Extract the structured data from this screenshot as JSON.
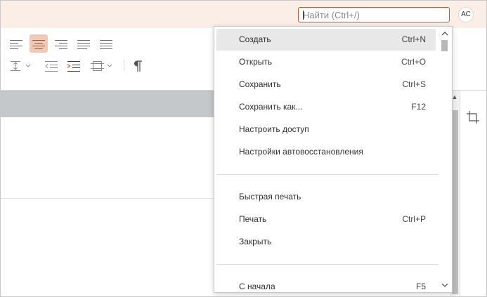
{
  "header": {
    "search_placeholder": "Найти (Ctrl+/)",
    "avatar_initials": "АС"
  },
  "colors": {
    "accent": "#c4573a",
    "titlebar_bg": "#fbeee7",
    "active_button_bg": "#f2c9b8"
  },
  "toolbar": {
    "row1_icons": [
      "align-left-icon",
      "align-center-icon",
      "align-right-icon",
      "align-justify-icon",
      "distributed-align-icon"
    ],
    "row2_icons": [
      "line-spacing-icon",
      "decrease-indent-icon",
      "increase-indent-icon",
      "margins-icon",
      "paragraph-marks-icon"
    ],
    "active": "align-center-icon"
  },
  "menu": {
    "items": [
      {
        "label": "Создать",
        "shortcut": "Ctrl+N"
      },
      {
        "label": "Открыть",
        "shortcut": "Ctrl+O"
      },
      {
        "label": "Сохранить",
        "shortcut": "Ctrl+S"
      },
      {
        "label": "Сохранить как...",
        "shortcut": "F12"
      },
      {
        "label": "Настроить доступ",
        "shortcut": ""
      },
      {
        "label": "Настройки автовосстановления",
        "shortcut": ""
      },
      {
        "label": "Быстрая печать",
        "shortcut": ""
      },
      {
        "label": "Печать",
        "shortcut": "Ctrl+P"
      },
      {
        "label": "Закрыть",
        "shortcut": ""
      },
      {
        "label": "С начала",
        "shortcut": "F5"
      }
    ],
    "hovered": "Создать"
  }
}
